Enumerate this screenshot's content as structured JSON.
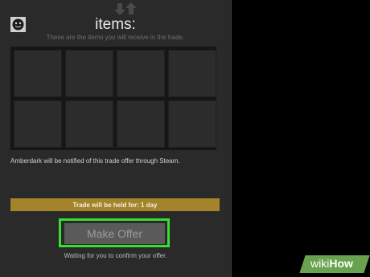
{
  "panel": {
    "title": "items:",
    "subtitle": "These are the items you will receive in the trade.",
    "slots": [
      1,
      2,
      3,
      4,
      5,
      6,
      7,
      8
    ],
    "notify_text": "Amberdark will be notified of this trade offer through Steam.",
    "hold_text": "Trade will be held for: 1 day",
    "offer_button": "Make Offer",
    "waiting_text": "Waiting for you to confirm your offer."
  },
  "watermark": {
    "part1": "wiki",
    "part2": "How"
  },
  "colors": {
    "accent_highlight": "#35e030",
    "hold_bar": "#a3842a"
  }
}
